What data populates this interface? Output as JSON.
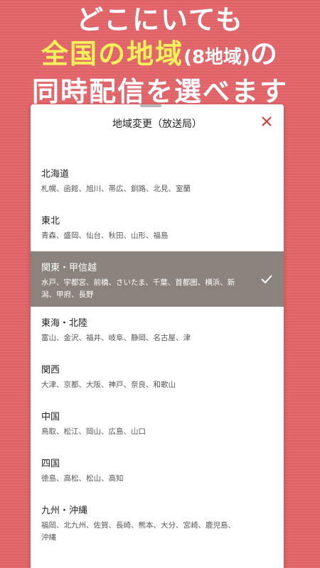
{
  "headline": {
    "line1": "どこにいても",
    "line2_accent": "全国の地域",
    "line2_paren": "(8地域)",
    "line2_end": "の",
    "line3": "同時配信を選べます"
  },
  "sheet": {
    "title": "地域変更（放送局）",
    "close_icon": "close-icon",
    "selected_icon": "check-icon",
    "regions": [
      {
        "name": "北海道",
        "cities": "札幌、函館、旭川、帯広、釧路、北見、室蘭"
      },
      {
        "name": "東北",
        "cities": "青森、盛岡、仙台、秋田、山形、福島"
      },
      {
        "name": "関東・甲信越",
        "cities": "水戸、宇都宮、前橋、さいたま、千葉、首都圏、横浜、新潟、甲府、長野"
      },
      {
        "name": "東海・北陸",
        "cities": "富山、金沢、福井、岐阜、静岡、名古屋、津"
      },
      {
        "name": "関西",
        "cities": "大津、京都、大阪、神戸、奈良、和歌山"
      },
      {
        "name": "中国",
        "cities": "鳥取、松江、岡山、広島、山口"
      },
      {
        "name": "四国",
        "cities": "徳島、高松、松山、高知"
      },
      {
        "name": "九州・沖縄",
        "cities": "福岡、北九州、佐賀、長崎、熊本、大分、宮崎、鹿児島、沖縄"
      }
    ]
  },
  "colors": {
    "background": "#e36a6f",
    "accent": "#f7f05a",
    "selected_row": "#8a827c",
    "close": "#d93a3a"
  }
}
